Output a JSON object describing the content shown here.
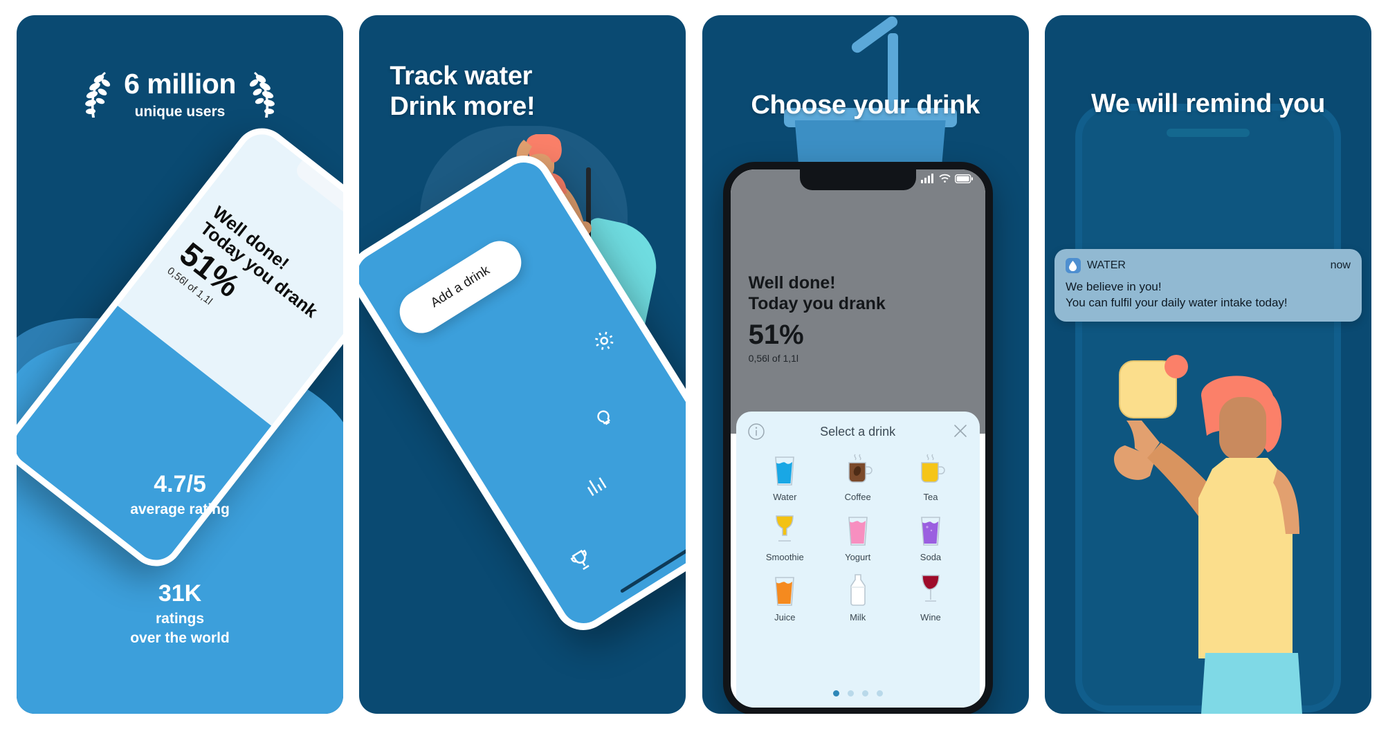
{
  "gallery": {
    "panels": [
      {
        "id": "panel-social-proof",
        "bg": "#0A4A72",
        "award": {
          "main": "6 million",
          "sub": "unique users",
          "icon": "laurel-wreath-icon"
        },
        "phone_screen": {
          "line1": "Well done!",
          "line2": "Today you drank",
          "percent": "51%",
          "volume": "0,56l of 1,1l"
        },
        "stats": [
          {
            "number": "4.7/5",
            "label": "average rating"
          },
          {
            "number": "31K",
            "label_line1": "ratings",
            "label_line2": "over the world"
          }
        ]
      },
      {
        "id": "panel-track-water",
        "bg": "#0A4A72",
        "headline_line1": "Track water",
        "headline_line2": "Drink more!",
        "phone_screen": {
          "add_button": "Add a drink",
          "icons": [
            "gear-icon",
            "lightbulb-icon",
            "bar-chart-icon",
            "trophy-icon"
          ]
        }
      },
      {
        "id": "panel-choose-drink",
        "bg": "#0A4A72",
        "headline": "Choose your drink",
        "phone_screen": {
          "line1": "Well done!",
          "line2": "Today you drank",
          "percent": "51%",
          "volume": "0,56l of 1,1l",
          "sheet_title": "Select a drink",
          "info_icon": "info-circle-icon",
          "close_icon": "close-x-icon",
          "drinks": [
            {
              "label": "Water",
              "icon": "glass-water-icon",
              "color": "#19A7E5"
            },
            {
              "label": "Coffee",
              "icon": "mug-coffee-icon",
              "color": "#7B4A2B"
            },
            {
              "label": "Tea",
              "icon": "mug-tea-icon",
              "color": "#F5C518"
            },
            {
              "label": "Smoothie",
              "icon": "glass-smoothie-icon",
              "color": "#F3C213"
            },
            {
              "label": "Yogurt",
              "icon": "glass-yogurt-icon",
              "color": "#F78FC0"
            },
            {
              "label": "Soda",
              "icon": "glass-soda-icon",
              "color": "#9B5FE0"
            },
            {
              "label": "Juice",
              "icon": "glass-juice-icon",
              "color": "#F58A1F"
            },
            {
              "label": "Milk",
              "icon": "bottle-milk-icon",
              "color": "#FFFFFF"
            },
            {
              "label": "Wine",
              "icon": "glass-wine-icon",
              "color": "#9E0B2A"
            }
          ],
          "pages": {
            "count": 4,
            "active": 1
          },
          "status_icons": [
            "signal-bars-icon",
            "wifi-icon",
            "battery-icon"
          ]
        }
      },
      {
        "id": "panel-reminders",
        "bg": "#0A4A72",
        "headline": "We will remind you",
        "notification": {
          "app_name": "WATER",
          "time": "now",
          "app_icon": "water-drop-app-icon",
          "body_line1": "We believe in you!",
          "body_line2": "You can fulfil your daily water intake today!"
        }
      }
    ]
  },
  "colors": {
    "navy": "#0A4A72",
    "blue": "#3C9FDB",
    "light_blue": "#E3F3FB",
    "accent_teal": "#6FDCE0",
    "skin": "#E2A06F",
    "hair": "#FB8069",
    "shirt": "#FBDE8C",
    "pants": "#7FD9E6",
    "notif_bg": "#91B9D2"
  }
}
